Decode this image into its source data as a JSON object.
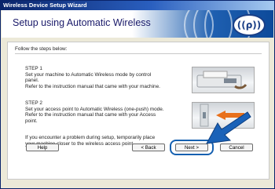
{
  "window": {
    "title": "Wireless Device Setup Wizard"
  },
  "header": {
    "title": "Setup using Automatic Wireless",
    "logo_text": "((ρ))"
  },
  "content": {
    "intro": "Follow the steps below:",
    "step1": {
      "title": "STEP 1",
      "lines": [
        "Set your machine to Automatic Wireless mode by control",
        "panel.",
        "Refer to the instruction manual that came with your machine."
      ]
    },
    "step2": {
      "title": "STEP 2",
      "lines": [
        "Set your access point to Automatic Wireless (one-push) mode.",
        "Refer to the instruction manual that came with your Access",
        "point."
      ]
    },
    "problem_lines": [
      "If you encounter a problem during setup, temporarily place",
      "your machine closer to the wireless access point."
    ]
  },
  "buttons": {
    "help": "Help",
    "back": "< Back",
    "next": "Next >",
    "cancel": "Cancel"
  },
  "icons": {
    "step1_image": "printer-control-panel-icon",
    "step2_image": "access-point-button-icon",
    "pointer": "blue-arrow-icon"
  },
  "colors": {
    "title_bar": "#0a246a",
    "header_blue": "#1e5fb0",
    "highlight": "#1560b0",
    "arrow": "#1a62b8",
    "orange_arrow": "#e8711c"
  }
}
